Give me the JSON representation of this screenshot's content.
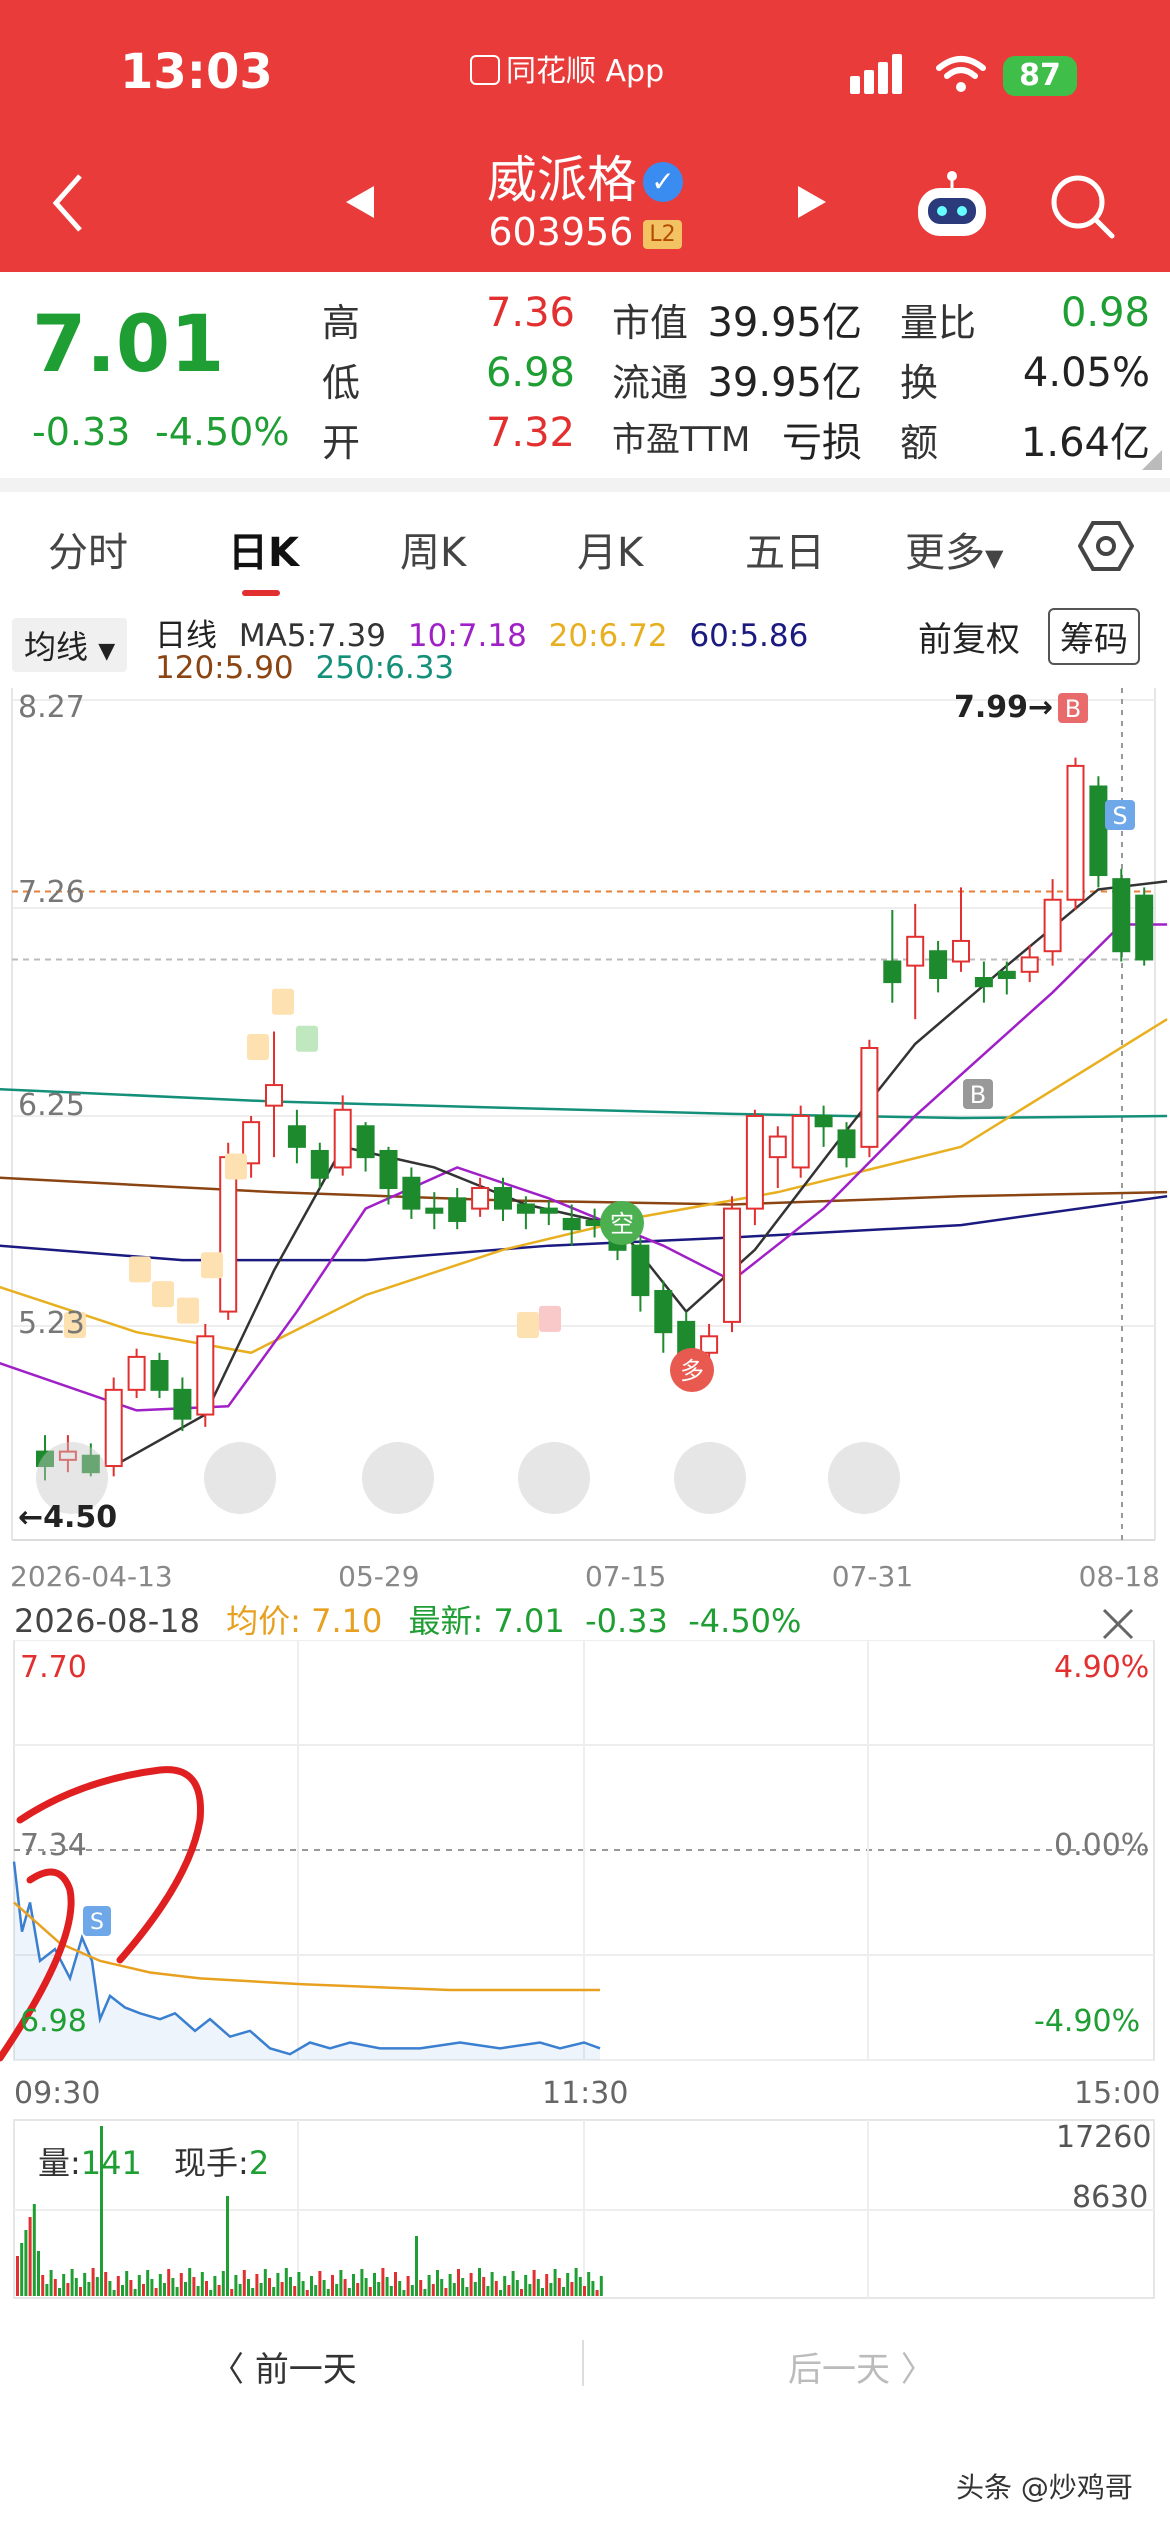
{
  "status_bar": {
    "time": "13:03",
    "app": "同花顺 App",
    "battery": "87"
  },
  "header": {
    "stock_name": "威派格",
    "stock_code": "603956",
    "level": "L2"
  },
  "quote": {
    "price": "7.01",
    "change": "-0.33",
    "change_pct": "-4.50%",
    "high_label": "高",
    "high": "7.36",
    "low_label": "低",
    "low": "6.98",
    "open_label": "开",
    "open": "7.32",
    "mcap_label": "市值",
    "mcap": "39.95亿",
    "float_label": "流通",
    "float": "39.95亿",
    "pe_label": "市盈TTM",
    "pe": "亏损",
    "vol_ratio_label": "量比",
    "vol_ratio": "0.98",
    "turnover_label": "换",
    "turnover": "4.05%",
    "amount_label": "额",
    "amount": "1.64亿"
  },
  "tabs": [
    "分时",
    "日K",
    "周K",
    "月K",
    "五日",
    "更多"
  ],
  "ma_legend": {
    "dropdown": "均线",
    "period": "日线",
    "ma5": "MA5:7.39",
    "ma10": "10:7.18",
    "ma20": "20:6.72",
    "ma60": "60:5.86",
    "ma120": "120:5.90",
    "ma250": "250:6.33",
    "adjust": "前复权",
    "chips": "筹码"
  },
  "kline": {
    "y_labels": [
      "8.27",
      "7.26",
      "6.25",
      "5.23"
    ],
    "high_mark": "7.99",
    "low_mark": "4.50",
    "x_labels": [
      "2026-04-13",
      "05-29",
      "07-15",
      "07-31",
      "08-18"
    ],
    "badges": {
      "kong": "空",
      "duo": "多",
      "b": "B",
      "s": "S"
    },
    "colors": {
      "up": "#e23030",
      "down": "#1e8a2e",
      "ma5": "#333333",
      "ma10": "#a020c8",
      "ma20": "#e8b020",
      "ma60": "#1a1a80",
      "ma120": "#8b4513",
      "ma250": "#14907a"
    }
  },
  "intraday": {
    "date": "2026-08-18",
    "avg_label": "均价:",
    "avg": "7.10",
    "latest_label": "最新:",
    "latest": "7.01",
    "change": "-0.33",
    "change_pct": "-4.50%",
    "y_top": "7.70",
    "y_mid": "7.34",
    "y_bottom": "6.98",
    "pct_top": "4.90%",
    "pct_mid": "0.00%",
    "pct_bottom": "-4.90%",
    "time_start": "09:30",
    "time_mid": "11:30",
    "time_end": "15:00",
    "vol_label": "量:",
    "vol": "141",
    "cur_hand_label": "现手:",
    "cur_hand": "2",
    "vol_top": "17260",
    "vol_mid": "8630"
  },
  "nav": {
    "prev": "前一天",
    "next": "后一天"
  },
  "watermark": "头条 @炒鸡哥"
}
